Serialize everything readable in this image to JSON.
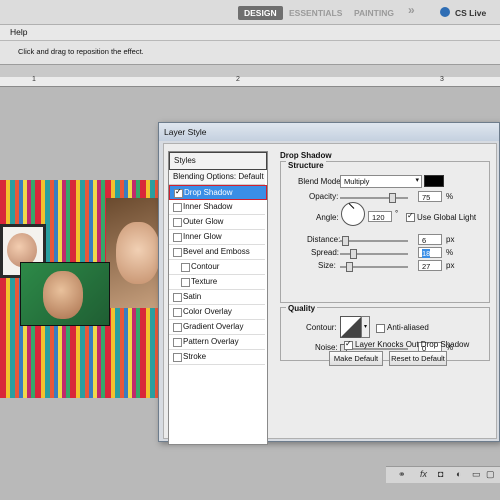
{
  "workspace": {
    "tabs": [
      "DESIGN",
      "ESSENTIALS",
      "PAINTING"
    ],
    "more": "»",
    "cslive": "CS Live"
  },
  "menubar": {
    "items": [
      "Help"
    ]
  },
  "options_bar": {
    "hint": "Click and drag to reposition the effect."
  },
  "ruler": {
    "labels": [
      "1",
      "2",
      "3"
    ]
  },
  "dialog": {
    "title": "Layer Style",
    "styles_header": "Styles",
    "blending_options": "Blending Options: Default",
    "items": [
      {
        "label": "Drop Shadow",
        "checked": true,
        "selected": true
      },
      {
        "label": "Inner Shadow",
        "checked": false
      },
      {
        "label": "Outer Glow",
        "checked": false
      },
      {
        "label": "Inner Glow",
        "checked": false
      },
      {
        "label": "Bevel and Emboss",
        "checked": false
      },
      {
        "label": "Contour",
        "checked": false
      },
      {
        "label": "Texture",
        "checked": false
      },
      {
        "label": "Satin",
        "checked": false
      },
      {
        "label": "Color Overlay",
        "checked": false
      },
      {
        "label": "Gradient Overlay",
        "checked": false
      },
      {
        "label": "Pattern Overlay",
        "checked": false
      },
      {
        "label": "Stroke",
        "checked": false
      }
    ],
    "drop_shadow": {
      "title": "Drop Shadow",
      "structure": "Structure",
      "blend_mode_label": "Blend Mode:",
      "blend_mode": "Multiply",
      "opacity_label": "Opacity:",
      "opacity": "75",
      "opacity_fraction": 0.75,
      "angle_label": "Angle:",
      "angle": "120",
      "deg": "°",
      "use_global_light": "Use Global Light",
      "distance_label": "Distance:",
      "distance": "6",
      "spread_label": "Spread:",
      "spread": "18",
      "size_label": "Size:",
      "size": "27",
      "px": "px",
      "pct": "%",
      "quality": "Quality",
      "contour_label": "Contour:",
      "anti_aliased": "Anti-aliased",
      "noise_label": "Noise:",
      "noise": "0",
      "layer_knocks_out": "Layer Knocks Out Drop Shadow",
      "make_default": "Make Default",
      "reset_to_default": "Reset to Default"
    }
  },
  "panel_icons": {
    "fx": "fx"
  }
}
